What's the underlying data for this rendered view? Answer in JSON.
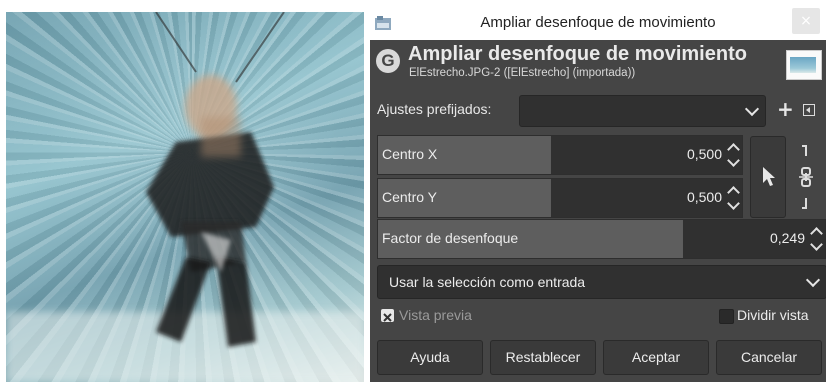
{
  "window": {
    "title": "Ampliar desenfoque de movimiento",
    "close_glyph": "×"
  },
  "header": {
    "logo_glyph": "G",
    "title": "Ampliar desenfoque de movimiento",
    "subtitle": "ElEstrecho.JPG-2 ([ElEstrecho] (importada))"
  },
  "presets": {
    "label": "Ajustes prefijados:",
    "value": "",
    "add_glyph": "+"
  },
  "center_x": {
    "label": "Centro X",
    "value": "0,500"
  },
  "center_y": {
    "label": "Centro Y",
    "value": "0,500"
  },
  "blur_factor": {
    "label": "Factor de desenfoque",
    "value": "0,249",
    "fill": 0.249
  },
  "input_mode": {
    "value": "Usar la selección como entrada"
  },
  "preview": {
    "label": "Vista previa",
    "checked": true
  },
  "split_view": {
    "label": "Dividir vista",
    "checked": false
  },
  "buttons": {
    "help": "Ayuda",
    "reset": "Restablecer",
    "ok": "Aceptar",
    "cancel": "Cancelar"
  },
  "icons": [
    "app-icon",
    "gimp-logo-icon",
    "close-icon",
    "chevron-down-icon",
    "plus-icon",
    "menu-icon",
    "pointer-pick-icon",
    "chain-link-icon",
    "checkbox-icon"
  ]
}
